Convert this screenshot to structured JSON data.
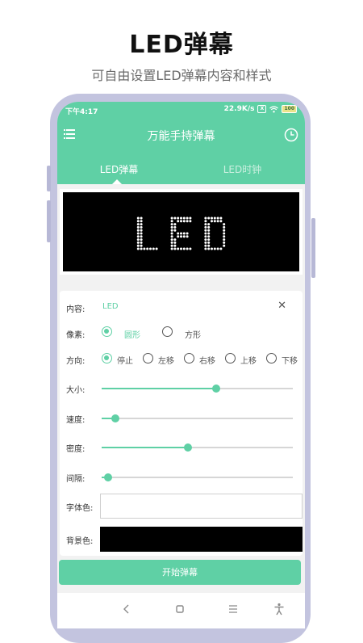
{
  "hero": {
    "title": "LED弹幕",
    "subtitle": "可自由设置LED弹幕内容和样式"
  },
  "status_bar": {
    "time": "下午4:17",
    "speed": "22.9K/s",
    "sim_badge": "X",
    "battery": "100"
  },
  "app_bar": {
    "title": "万能手持弹幕",
    "menu_icon": "menu-icon",
    "history_icon": "clock-icon"
  },
  "tabs": [
    {
      "label": "LED弹幕",
      "active": true
    },
    {
      "label": "LED时钟",
      "active": false
    }
  ],
  "preview": {
    "text": "LED",
    "background": "#000000",
    "dot_color": "#ffffff"
  },
  "settings": {
    "content": {
      "label": "内容:",
      "value": "LED",
      "clear_icon": "close-icon"
    },
    "pixel": {
      "label": "像素:",
      "options": [
        {
          "label": "圆形",
          "selected": true
        },
        {
          "label": "方形",
          "selected": false
        }
      ]
    },
    "direction": {
      "label": "方向:",
      "options": [
        {
          "label": "停止",
          "selected": true
        },
        {
          "label": "左移",
          "selected": false
        },
        {
          "label": "右移",
          "selected": false
        },
        {
          "label": "上移",
          "selected": false
        },
        {
          "label": "下移",
          "selected": false
        }
      ]
    },
    "sliders": [
      {
        "key": "size",
        "label": "大小:",
        "fraction": 0.6
      },
      {
        "key": "speed",
        "label": "速度:",
        "fraction": 0.07
      },
      {
        "key": "density",
        "label": "密度:",
        "fraction": 0.45
      },
      {
        "key": "spacing",
        "label": "间隔:",
        "fraction": 0.035
      }
    ],
    "font_color": {
      "label": "字体色:",
      "value": "#ffffff"
    },
    "background_color": {
      "label": "背景色:",
      "value": "#000000"
    }
  },
  "start_button": "开始弹幕",
  "nav_bar": {
    "icons": [
      "back-icon",
      "home-icon",
      "recent-apps-icon",
      "accessibility-icon"
    ]
  },
  "colors": {
    "accent": "#5fd0a5",
    "frame": "#c3c4df"
  }
}
